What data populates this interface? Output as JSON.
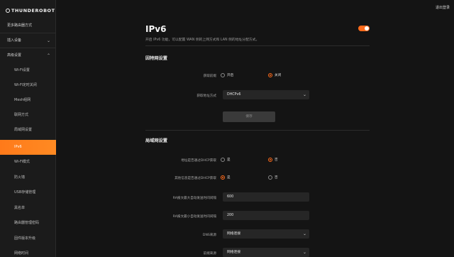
{
  "brand": {
    "logo_text": "THUNDEROBOT"
  },
  "sidebar": {
    "items": [
      {
        "label": "更多路由器方式"
      },
      {
        "label": "插入设备",
        "chevron": "⌄"
      },
      {
        "label": "高级设置",
        "chevron": "⌃"
      },
      {
        "label": "Wi-Fi设置"
      },
      {
        "label": "Wi-Fi定时关闭"
      },
      {
        "label": "Mesh组网"
      },
      {
        "label": "联网方式"
      },
      {
        "label": "局域网设置"
      },
      {
        "label": "IPv6"
      },
      {
        "label": "Wi-Fi模式"
      },
      {
        "label": "防火墙"
      },
      {
        "label": "USB存储管理"
      },
      {
        "label": "黑名单"
      },
      {
        "label": "路由器管理密码"
      },
      {
        "label": "固件版本升级"
      },
      {
        "label": "网络时间"
      }
    ]
  },
  "header": {
    "top_link": "退出登录"
  },
  "page": {
    "title": "IPv6",
    "description": "开启 IPv6 功能，可以配置 WAN 侧的上网方式和 LAN 侧的地址分配方式。",
    "toggle_on": true
  },
  "wan": {
    "section_title": "因特网设置",
    "get_prefix_label": "获取前缀",
    "opt_on": "开启",
    "opt_off": "关闭",
    "addr_mode_label": "获取地址方式",
    "addr_mode_value": "DHCPv6",
    "save_label": "保存"
  },
  "lan": {
    "section_title": "局域网设置",
    "addr_dhcp_label": "地址是否通过DHCP获取",
    "addr_dhcp_yes": "是",
    "addr_dhcp_no": "否",
    "other_dhcp_label": "其他信息是否通过DHCP获取",
    "other_dhcp_yes": "是",
    "other_dhcp_no": "否",
    "ra_max_label": "RA报文最大自动发送时间间隔",
    "ra_max_value": "600",
    "ra_min_label": "RA报文最小自动发送时间间隔",
    "ra_min_value": "200",
    "dns_label": "DNS来源",
    "dns_value": "网络连接",
    "prefix_src_label": "前缀来源",
    "prefix_src_value": "网络连接"
  },
  "icons": {
    "chevron_down": "⌄",
    "select_arrow": "⌄"
  },
  "colors": {
    "accent": "#ff7a1a",
    "background": "#141414",
    "sidebar": "#1b1b1b",
    "field": "#262626"
  }
}
